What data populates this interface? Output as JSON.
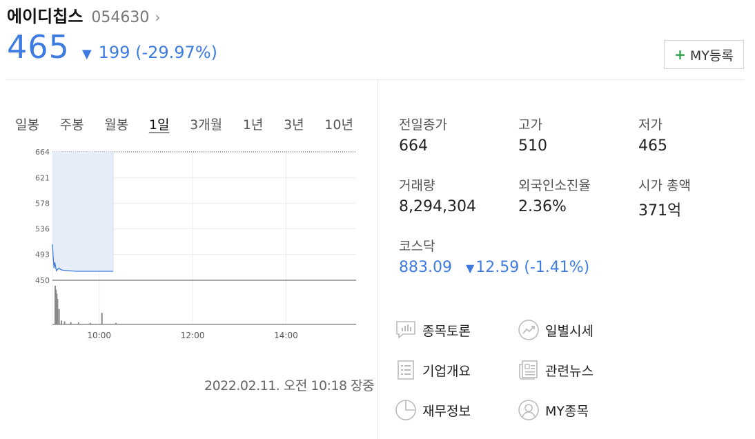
{
  "header": {
    "name": "에이디칩스",
    "code": "054630",
    "chevron": "›",
    "price": "465",
    "down_symbol": "▼",
    "change": "199 (-29.97%)",
    "my_button_plus": "+",
    "my_button_label": "MY등록"
  },
  "periods": [
    "일봉",
    "주봉",
    "월봉",
    "1일",
    "3개월",
    "1년",
    "3년",
    "10년"
  ],
  "active_period": "1일",
  "timestamp": "2022.02.11. 오전 10:18 장중",
  "stats": {
    "prev_close_label": "전일종가",
    "prev_close": "664",
    "high_label": "고가",
    "high": "510",
    "low_label": "저가",
    "low": "465",
    "volume_label": "거래량",
    "volume": "8,294,304",
    "foreign_label": "외국인소진율",
    "foreign": "2.36%",
    "mcap_label": "시가 총액",
    "mcap": "371억",
    "index_label": "코스닥",
    "index_value": "883.09",
    "index_down_symbol": "▼",
    "index_change": "12.59 (-1.41%)"
  },
  "links": {
    "discussion": "종목토론",
    "daily": "일별시세",
    "overview": "기업개요",
    "news": "관련뉴스",
    "financial": "재무정보",
    "my_stocks": "MY종목"
  },
  "colors": {
    "accent": "#3d7be0",
    "plus_green": "#2aa24a",
    "area_fill": "#e6edf9",
    "volume_bar": "#888888"
  },
  "chart_data": {
    "type": "line",
    "y_ticks": [
      "664",
      "621",
      "578",
      "536",
      "493",
      "450"
    ],
    "x_ticks": [
      "10:00",
      "12:00",
      "14:00"
    ],
    "ylim": [
      450,
      664
    ],
    "reference_line": 664,
    "x": [
      "09:00",
      "09:01",
      "09:02",
      "09:03",
      "09:05",
      "09:08",
      "09:12",
      "09:20",
      "09:30",
      "09:45",
      "10:00",
      "10:18"
    ],
    "price": [
      510,
      488,
      470,
      480,
      466,
      470,
      467,
      466,
      465,
      465,
      465,
      465
    ],
    "volume": [
      100,
      90,
      80,
      66,
      40,
      10,
      8,
      6,
      5,
      4,
      30,
      4
    ]
  }
}
